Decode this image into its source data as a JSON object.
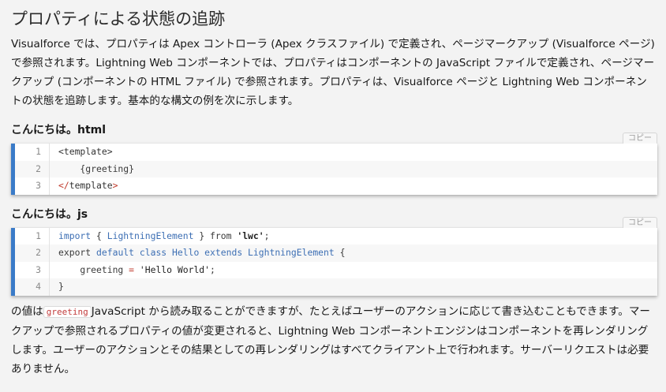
{
  "heading": "プロパティによる状態の追跡",
  "intro": "Visualforce では、プロパティは Apex コントローラ (Apex クラスファイル) で定義され、ページマークアップ (Visualforce ページ) で参照されます。Lightning Web コンポーネントでは、プロパティはコンポーネントの JavaScript ファイルで定義され、ページマークアップ (コンポーネントの HTML ファイル) で参照されます。プロパティは、Visualforce ページと Lightning Web コンポーネントの状態を追跡します。基本的な構文の例を次に示します。",
  "copy_label": "コピー",
  "html_block": {
    "filename": "こんにちは。html",
    "lines": [
      {
        "n": "1",
        "parts": [
          {
            "t": "<template>",
            "c": "tok-tag"
          }
        ]
      },
      {
        "n": "2",
        "parts": [
          {
            "t": "    {greeting}",
            "c": "tok-plain"
          }
        ]
      },
      {
        "n": "3",
        "parts": [
          {
            "t": "</",
            "c": "tok-close"
          },
          {
            "t": "template",
            "c": "tok-tag"
          },
          {
            "t": ">",
            "c": "tok-close"
          }
        ]
      }
    ]
  },
  "js_block": {
    "filename": "こんにちは。js",
    "lines": [
      {
        "n": "1",
        "parts": [
          {
            "t": "import",
            "c": "tok-kw"
          },
          {
            "t": " { ",
            "c": "tok-plain"
          },
          {
            "t": "LightningElement",
            "c": "tok-kw"
          },
          {
            "t": " } from ",
            "c": "tok-plain"
          },
          {
            "t": "'lwc'",
            "c": "tok-str"
          },
          {
            "t": ";",
            "c": "tok-plain"
          }
        ]
      },
      {
        "n": "2",
        "parts": [
          {
            "t": "export ",
            "c": "tok-plain"
          },
          {
            "t": "default class Hello extends LightningElement",
            "c": "tok-kw"
          },
          {
            "t": " {",
            "c": "tok-plain"
          }
        ]
      },
      {
        "n": "3",
        "parts": [
          {
            "t": "    greeting ",
            "c": "tok-plain"
          },
          {
            "t": "=",
            "c": "tok-op"
          },
          {
            "t": " ",
            "c": "tok-plain"
          },
          {
            "t": "'Hello World'",
            "c": "tok-strq"
          },
          {
            "t": ";",
            "c": "tok-plain"
          }
        ]
      },
      {
        "n": "4",
        "parts": [
          {
            "t": "}",
            "c": "tok-plain"
          }
        ]
      }
    ]
  },
  "outro": {
    "before": "の値は",
    "code": "greeting",
    "after": "JavaScript から読み取ることができますが、たとえばユーザーのアクションに応じて書き込むこともできます。マークアップで参照されるプロパティの値が変更されると、Lightning Web コンポーネントエンジンはコンポーネントを再レンダリングします。ユーザーのアクションとその結果としての再レンダリングはすべてクライアント上で行われます。サーバーリクエストは必要ありません。"
  },
  "colors": {
    "accent_bar": "#3a7bc8",
    "keyword": "#3d6fb4",
    "tag_close": "#c0392b",
    "inline_code": "#c23a3a"
  }
}
